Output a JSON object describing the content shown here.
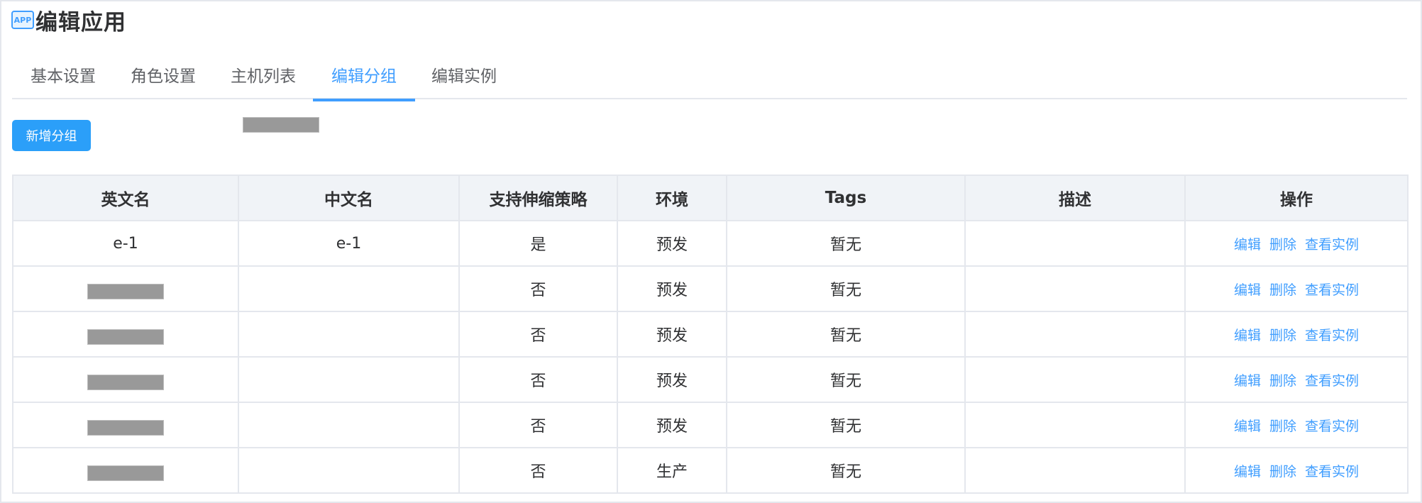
{
  "app_icon_text": "APP",
  "page_title": "编辑应用",
  "tabs": [
    {
      "label": "基本设置",
      "active": false
    },
    {
      "label": "角色设置",
      "active": false
    },
    {
      "label": "主机列表",
      "active": false
    },
    {
      "label": "编辑分组",
      "active": true
    },
    {
      "label": "编辑实例",
      "active": false
    }
  ],
  "add_button_label": "新增分组",
  "table": {
    "columns": [
      "英文名",
      "中文名",
      "支持伸缩策略",
      "环境",
      "Tags",
      "描述",
      "操作"
    ],
    "rows": [
      {
        "en_name": "e-1",
        "en_redacted": false,
        "cn_name": "e-1",
        "scaling": "是",
        "env": "预发",
        "tags": "暂无",
        "desc": ""
      },
      {
        "en_name": "",
        "en_redacted": true,
        "cn_name": "",
        "scaling": "否",
        "env": "预发",
        "tags": "暂无",
        "desc": ""
      },
      {
        "en_name": "",
        "en_redacted": true,
        "cn_name": "",
        "scaling": "否",
        "env": "预发",
        "tags": "暂无",
        "desc": ""
      },
      {
        "en_name": "",
        "en_redacted": true,
        "cn_name": "",
        "scaling": "否",
        "env": "预发",
        "tags": "暂无",
        "desc": ""
      },
      {
        "en_name": "",
        "en_redacted": true,
        "cn_name": "",
        "scaling": "否",
        "env": "预发",
        "tags": "暂无",
        "desc": ""
      },
      {
        "en_name": "",
        "en_redacted": true,
        "cn_name": "",
        "scaling": "否",
        "env": "生产",
        "tags": "暂无",
        "desc": ""
      }
    ],
    "actions": [
      "编辑",
      "删除",
      "查看实例"
    ]
  },
  "colors": {
    "accent": "#409eff",
    "button_bg": "#2b9ff9",
    "header_bg": "#f0f3f7",
    "border": "#e4e7ed",
    "redaction": "#999999"
  }
}
